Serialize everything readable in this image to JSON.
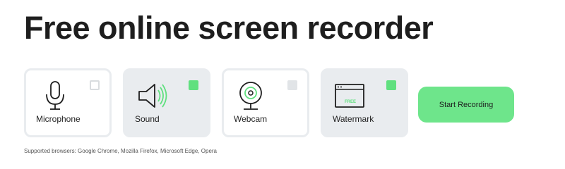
{
  "page": {
    "title": "Free online screen recorder"
  },
  "options": [
    {
      "id": "microphone",
      "label": "Microphone",
      "icon": "microphone-icon",
      "checked": false
    },
    {
      "id": "sound",
      "label": "Sound",
      "icon": "speaker-icon",
      "checked": true
    },
    {
      "id": "webcam",
      "label": "Webcam",
      "icon": "webcam-icon",
      "checked": false
    },
    {
      "id": "watermark",
      "label": "Watermark",
      "icon": "watermark-icon",
      "checked": true,
      "badge": "FREE"
    }
  ],
  "actions": {
    "start_label": "Start Recording"
  },
  "footer": {
    "supported_browsers": "Supported browsers: Google Chrome, Mozilla Firefox, Microsoft Edge, Opera"
  },
  "colors": {
    "accent": "#6ee58b",
    "checked": "#60e07f",
    "card_bg": "#e9ecef",
    "text": "#1e1e1e"
  }
}
